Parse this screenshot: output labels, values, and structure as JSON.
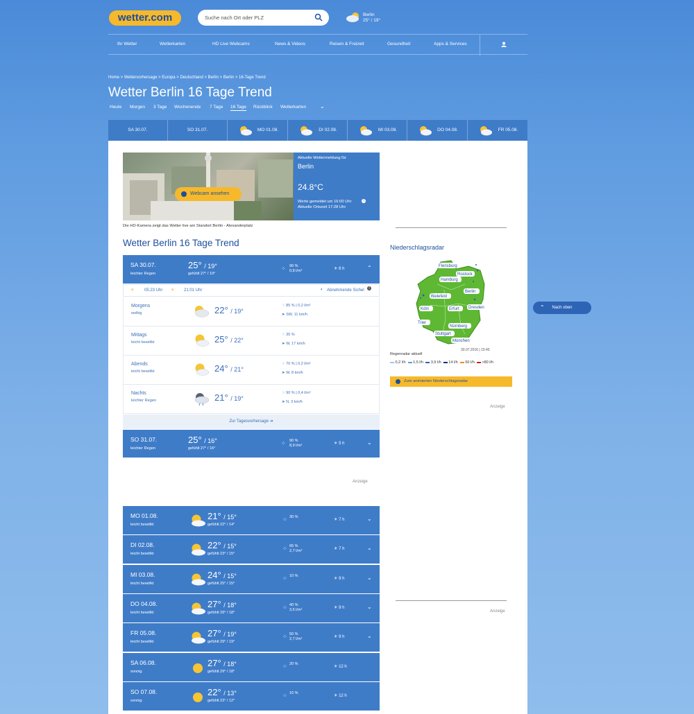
{
  "header": {
    "logo": "wetter.com",
    "search_placeholder": "Suche nach Ort oder PLZ",
    "city": "Berlin",
    "city_temp": "25° / 19°"
  },
  "nav": [
    "Ihr Wetter",
    "Wetterkarten",
    "HD Live Webcams",
    "News & Videos",
    "Reisen & Freizeit",
    "Gesundheit",
    "Apps & Services"
  ],
  "breadcrumb": "Home > Wettervorhersage > Europa > Deutschland > Berlin > Berlin > 16-Tage Trend",
  "page_title": "Wetter Berlin 16 Tage Trend",
  "tabs": [
    "Heute",
    "Morgen",
    "3 Tage",
    "Wochenende",
    "7 Tage",
    "16 Tage",
    "Rückblick",
    "Wetterkarten"
  ],
  "daystrip": [
    "SA 30.07.",
    "SO 31.07.",
    "MO 01.08.",
    "DI 02.08.",
    "MI 03.08.",
    "DO 04.08.",
    "FR 05.08."
  ],
  "webcam": {
    "button": "Webcam ansehen",
    "report_label": "Aktuelle Wettermeldung für",
    "city": "Berlin",
    "temp": "24.8°C",
    "reported": "Werte gemeldet um 16:00 Uhr",
    "local_time": "Aktuelle Ortszeit 17:28 Uhr",
    "caption": "Die HD-Kamera zeigt das Wetter live am Standort Berlin - Alexanderplatz"
  },
  "section_title": "Wetter Berlin 16 Tage Trend",
  "day_today": {
    "day": "SA 30.07.",
    "desc": "leichter Regen",
    "max": "25°",
    "min": "/ 19°",
    "felt": "gefühlt   27° / 19°",
    "rain_pct": "90 %",
    "rain_amt": "0,8 l/m²",
    "sun": "6 h"
  },
  "sun_times": {
    "sunrise": "05:23 Uhr",
    "sunset": "21:01 Uhr",
    "moon": "Abnehmende Sichel"
  },
  "parts": [
    {
      "name": "Morgens",
      "desc": "wolkig",
      "max": "22°",
      "min": "/ 19°",
      "p1": "85 %  |  0,2 l/m²",
      "p2": "SW, 11 km/h"
    },
    {
      "name": "Mittags",
      "desc": "leicht bewölkt",
      "max": "25°",
      "min": "/ 22°",
      "p1": "35 %",
      "p2": "W, 17 km/h"
    },
    {
      "name": "Abends",
      "desc": "leicht bewölkt",
      "max": "24°",
      "min": "/ 21°",
      "p1": "70 %  |  0,2 l/m²",
      "p2": "W, 8 km/h"
    },
    {
      "name": "Nachts",
      "desc": "leichter Regen",
      "max": "21°",
      "min": "/ 19°",
      "p1": "90 %  |  0,4 l/m²",
      "p2": "N, 3 km/h"
    }
  ],
  "tagesvorhersage_link": "Zur Tagesvorhersage",
  "day_sun": {
    "day": "SO 31.07.",
    "desc": "leichter Regen",
    "max": "25°",
    "min": "/ 16°",
    "felt": "gefühlt   27° / 16°",
    "rain_pct": "90 %",
    "rain_amt": "8,9 l/m²",
    "sun": "5 h"
  },
  "ad_label": "Anzeige",
  "days": [
    {
      "day": "MO 01.08.",
      "desc": "leicht bewölkt",
      "max": "21°",
      "min": "/ 15°",
      "felt": "gefühlt   22° / 14°",
      "rain_pct": "30 %",
      "rain_amt": "",
      "sun": "7 h",
      "icon": "sun-cloud"
    },
    {
      "day": "DI 02.08.",
      "desc": "leicht bewölkt",
      "max": "22°",
      "min": "/ 15°",
      "felt": "gefühlt   23° / 15°",
      "rain_pct": "65 %",
      "rain_amt": "2,7 l/m²",
      "sun": "7 h",
      "icon": "sun-cloud"
    },
    {
      "day": "MI 03.08.",
      "desc": "leicht bewölkt",
      "max": "24°",
      "min": "/ 15°",
      "felt": "gefühlt   25° / 15°",
      "rain_pct": "10 %",
      "rain_amt": "",
      "sun": "9 h",
      "icon": "sun-cloud"
    },
    {
      "day": "DO 04.08.",
      "desc": "leicht bewölkt",
      "max": "27°",
      "min": "/ 18°",
      "felt": "gefühlt   29° / 18°",
      "rain_pct": "40 %",
      "rain_amt": "3,5 l/m²",
      "sun": "9 h",
      "icon": "sun-cloud"
    },
    {
      "day": "FR 05.08.",
      "desc": "leicht bewölkt",
      "max": "27°",
      "min": "/ 19°",
      "felt": "gefühlt   29° / 19°",
      "rain_pct": "50 %",
      "rain_amt": "2,7 l/m²",
      "sun": "9 h",
      "icon": "sun-cloud"
    },
    {
      "day": "SA 06.08.",
      "desc": "sonnig",
      "max": "27°",
      "min": "/ 18°",
      "felt": "gefühlt   29° / 18°",
      "rain_pct": "20 %",
      "rain_amt": "",
      "sun": "12 h",
      "icon": "sun"
    },
    {
      "day": "SO 07.08.",
      "desc": "sonnig",
      "max": "22°",
      "min": "/ 13°",
      "felt": "gefühlt   23° / 12°",
      "rain_pct": "10 %",
      "rain_amt": "",
      "sun": "12 h",
      "icon": "sun"
    }
  ],
  "radar": {
    "title": "Niederschlagsradar",
    "cities": [
      "Flensburg",
      "Rostock",
      "Hamburg",
      "Berlin",
      "Bielefeld",
      "Köln",
      "Erfurt",
      "Dresden",
      "Trier",
      "Nürnberg",
      "Stuttgart",
      "München"
    ],
    "timestamp": "30.07.2016 | 15:45",
    "legend_title": "Regenradar aktuell",
    "legend": [
      "0,2 l/h",
      "1,5 l/h",
      "3,9 l/h",
      "14 l/h",
      "50 l/h",
      ">80 l/h"
    ],
    "legend_colors": [
      "#9ec5f0",
      "#5b9be0",
      "#2a5ec8",
      "#112a8a",
      "#f08a1a",
      "#d41b1b"
    ],
    "button": "Zum animierten Niederschlagsradar"
  },
  "back_to_top": "Nach oben"
}
